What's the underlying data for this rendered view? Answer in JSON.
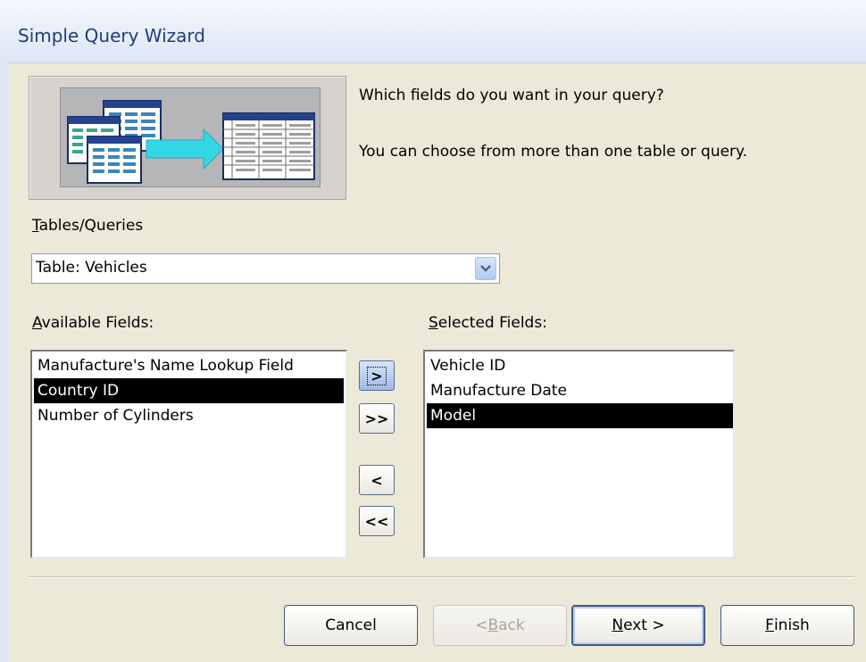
{
  "window": {
    "title": "Simple Query Wizard"
  },
  "intro": {
    "question": "Which fields do you want in your query?",
    "note": "You can choose from more than one table or query."
  },
  "tables_queries": {
    "label_prefix": "T",
    "label_rest": "ables/Queries",
    "value": "Table: Vehicles"
  },
  "available": {
    "label_prefix": "A",
    "label_rest": "vailable Fields:",
    "items": [
      {
        "label": "Manufacture's Name Lookup Field",
        "selected": false
      },
      {
        "label": "Country ID",
        "selected": true
      },
      {
        "label": "Number of Cylinders",
        "selected": false
      }
    ]
  },
  "selected": {
    "label_prefix": "S",
    "label_rest": "elected Fields:",
    "items": [
      {
        "label": "Vehicle ID",
        "selected": false
      },
      {
        "label": "Manufacture Date",
        "selected": false
      },
      {
        "label": "Model",
        "selected": true
      }
    ]
  },
  "move_buttons": {
    "add_one": ">",
    "add_all": ">>",
    "remove_one": "<",
    "remove_all": "<<"
  },
  "footer": {
    "cancel": "Cancel",
    "back_prefix": "< ",
    "back_key": "B",
    "back_rest": "ack",
    "next_key": "N",
    "next_rest": "ext >",
    "finish_key": "F",
    "finish_rest": "inish"
  }
}
